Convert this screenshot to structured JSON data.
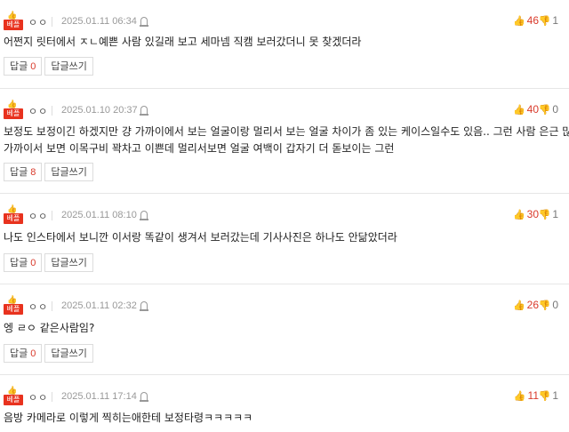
{
  "badge_label": "베플",
  "reply_label": "답글",
  "write_reply_label": "답글쓰기",
  "comments": [
    {
      "nick": "ㅇㅇ",
      "date": "2025.01.11 06:34",
      "up": "46",
      "down": "1",
      "lines": [
        "어쩐지 릿터에서 ㅈㄴ예쁜 사람 있길래 보고 세마넴 직캠 보러갔더니 못 찾겠더라"
      ],
      "replies": "0"
    },
    {
      "nick": "ㅇㅇ",
      "date": "2025.01.10 20:37",
      "up": "40",
      "down": "0",
      "lines": [
        "보정도 보정이긴 하겠지만 걍 가까이에서 보는 얼굴이랑 멀리서 보는 얼굴 차이가 좀 있는 케이스일수도 있음.. 그런 사람 은근 많아",
        "가까이서 보면 이목구비 꽉차고 이쁜데 멀리서보면 얼굴 여백이 갑자기 더 돋보이는 그런"
      ],
      "replies": "8"
    },
    {
      "nick": "ㅇㅇ",
      "date": "2025.01.11 08:10",
      "up": "30",
      "down": "1",
      "lines": [
        "나도 인스타에서 보니깐 이서랑 똑같이 생겨서 보러갔는데 기사사진은 하나도 안닮았더라"
      ],
      "replies": "0"
    },
    {
      "nick": "ㅇㅇ",
      "date": "2025.01.11 02:32",
      "up": "26",
      "down": "0",
      "lines": [
        "엥 ㄹㅇ 같은사람임?"
      ],
      "replies": "0"
    },
    {
      "nick": "ㅇㅇ",
      "date": "2025.01.11 17:14",
      "up": "11",
      "down": "1",
      "lines": [
        "음방 카메라로 이렇게 찍히는애한테 보정타령ㅋㅋㅋㅋㅋ"
      ],
      "replies": ""
    }
  ]
}
